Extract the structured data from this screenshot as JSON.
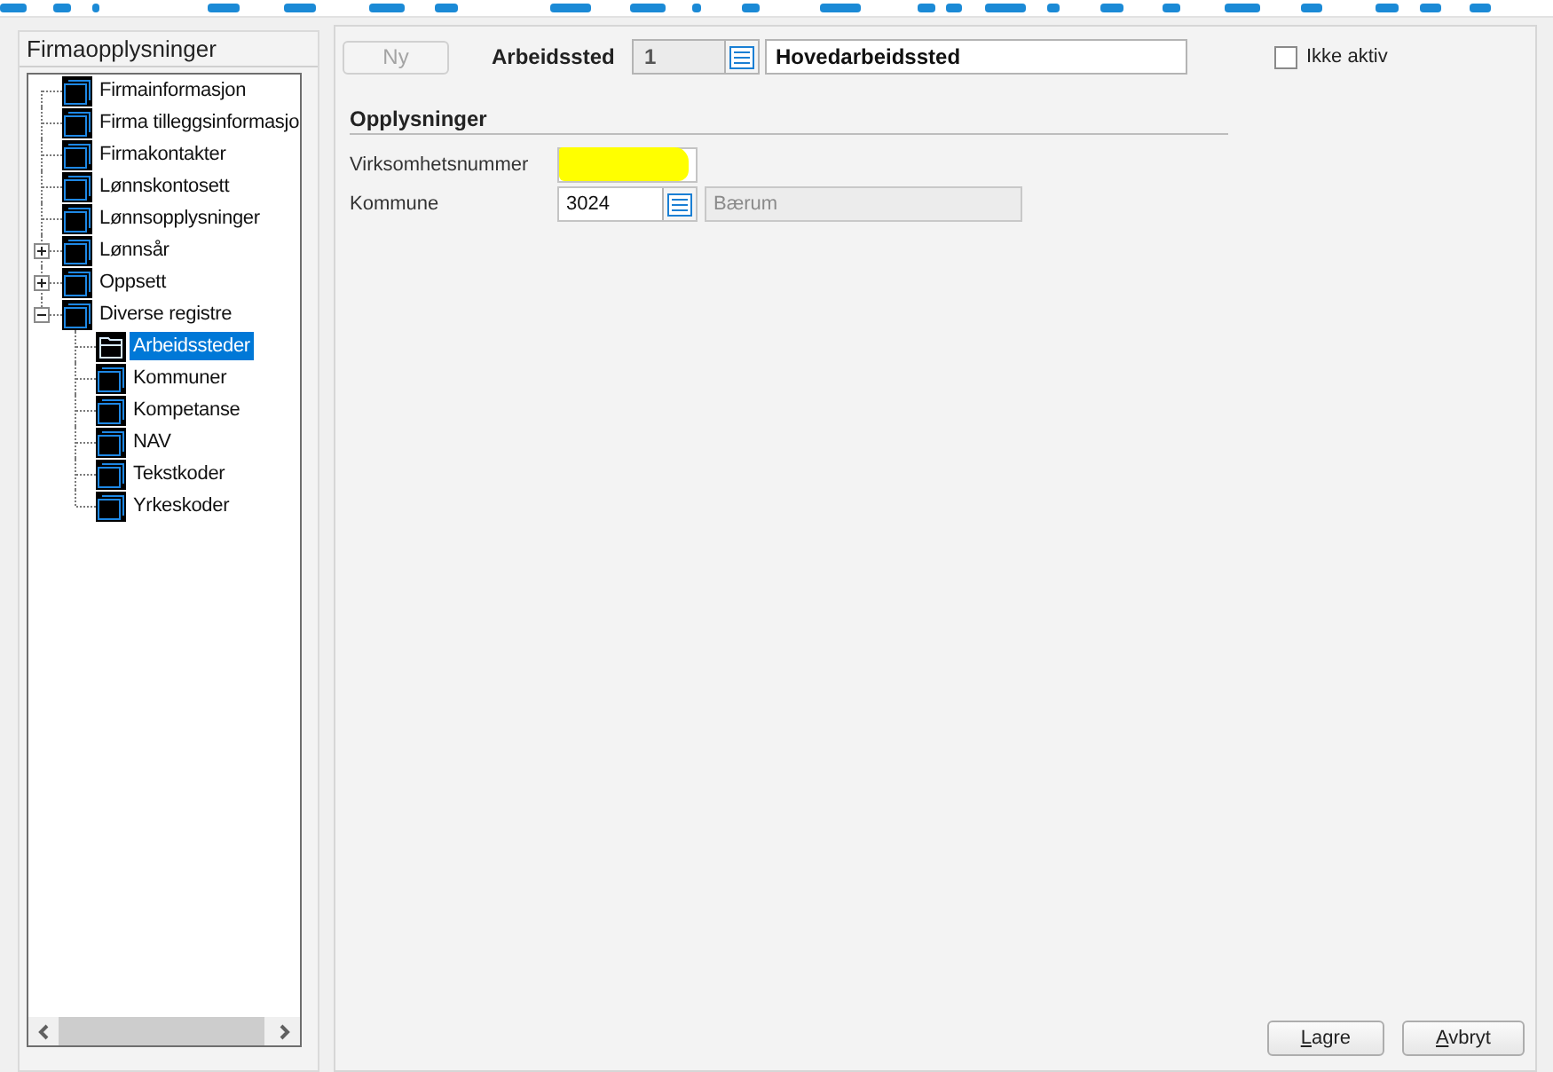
{
  "sidebar": {
    "title": "Firmaopplysninger",
    "tree": [
      {
        "kind": "leaf",
        "label": "Firmainformasjon",
        "selected": false
      },
      {
        "kind": "leaf",
        "label": "Firma tilleggsinformasjo",
        "selected": false
      },
      {
        "kind": "leaf",
        "label": "Firmakontakter",
        "selected": false
      },
      {
        "kind": "leaf",
        "label": "Lønnskontosett",
        "selected": false
      },
      {
        "kind": "leaf",
        "label": "Lønnsopplysninger",
        "selected": false
      },
      {
        "kind": "group",
        "label": "Lønnsår",
        "selected": false,
        "expanded": false
      },
      {
        "kind": "group",
        "label": "Oppsett",
        "selected": false,
        "expanded": false
      },
      {
        "kind": "group",
        "label": "Diverse registre",
        "selected": false,
        "expanded": true,
        "children": [
          {
            "kind": "leaf",
            "label": "Arbeidssteder",
            "selected": true
          },
          {
            "kind": "leaf",
            "label": "Kommuner",
            "selected": false
          },
          {
            "kind": "leaf",
            "label": "Kompetanse",
            "selected": false
          },
          {
            "kind": "leaf",
            "label": "NAV",
            "selected": false
          },
          {
            "kind": "leaf",
            "label": "Tekstkoder",
            "selected": false
          },
          {
            "kind": "leaf",
            "label": "Yrkeskoder",
            "selected": false
          }
        ]
      }
    ]
  },
  "header": {
    "new_button": {
      "label": "Ny",
      "disabled": true
    },
    "workplace_label": "Arbeidssted",
    "workplace_number": "1",
    "workplace_name": "Hovedarbeidssted",
    "inactive": {
      "label": "Ikke aktiv",
      "checked": false
    }
  },
  "details": {
    "title": "Opplysninger",
    "fields": [
      {
        "kind": "text",
        "label": "Virksomhetsnummer",
        "highlighted": true
      },
      {
        "kind": "lookup",
        "label": "Kommune",
        "value": "3024",
        "description": "Bærum",
        "highlighted": false
      }
    ]
  },
  "buttons": [
    {
      "label": "Lagre",
      "underline_first": true
    },
    {
      "label": "Avbryt",
      "underline_first": true
    }
  ]
}
